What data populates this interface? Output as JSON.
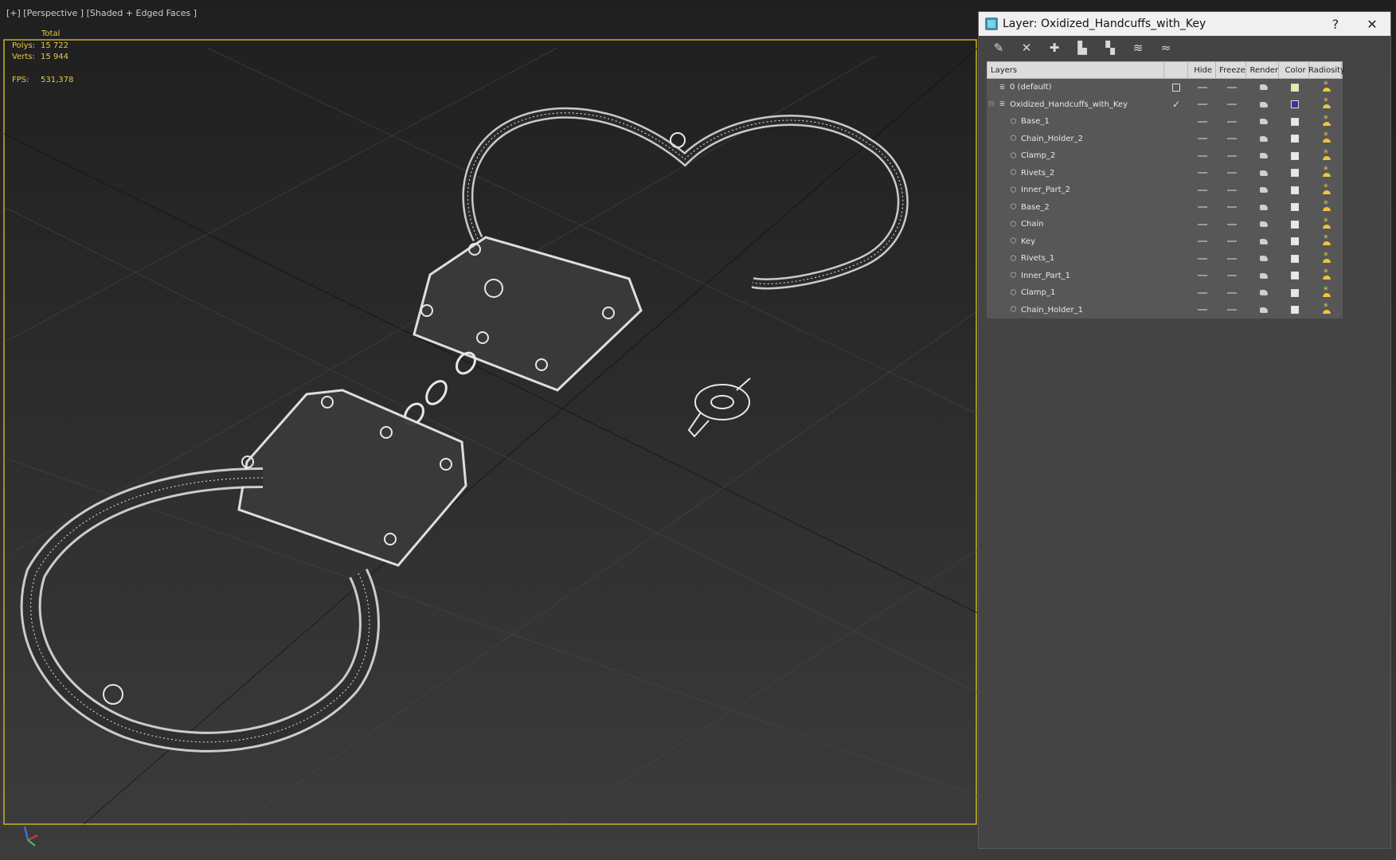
{
  "viewport": {
    "label": "[+] [Perspective ] [Shaded + Edged Faces ]",
    "stats": {
      "total_label": "Total",
      "polys_label": "Polys:",
      "polys": "15 722",
      "verts_label": "Verts:",
      "verts": "15 944",
      "fps_label": "FPS:",
      "fps": "531,378"
    }
  },
  "layer_dialog": {
    "title": "Layer: Oxidized_Handcuffs_with_Key",
    "help": "?",
    "close": "✕",
    "toolbar_icons": [
      "new-layer-icon",
      "delete-layer-icon",
      "add-to-layer-icon",
      "select-objects-icon",
      "select-layer-icon",
      "set-current-layer-icon",
      "hide-freeze-icon"
    ],
    "columns": {
      "layers": "Layers",
      "hide": "Hide",
      "freeze": "Freeze",
      "render": "Render",
      "color": "Color",
      "radiosity": "Radiosity"
    },
    "rows": [
      {
        "name": "0 (default)",
        "level": 0,
        "current": "box",
        "color": "#e8e8a0"
      },
      {
        "name": "Oxidized_Handcuffs_with_Key",
        "level": 0,
        "current": "check",
        "color": "#4b2a9a",
        "expander": "⊟"
      },
      {
        "name": "Base_1",
        "level": 1,
        "color": "#e8e8e8"
      },
      {
        "name": "Chain_Holder_2",
        "level": 1,
        "color": "#e8e8e8"
      },
      {
        "name": "Clamp_2",
        "level": 1,
        "color": "#e8e8e8"
      },
      {
        "name": "Rivets_2",
        "level": 1,
        "color": "#e8e8e8"
      },
      {
        "name": "Inner_Part_2",
        "level": 1,
        "color": "#e8e8e8"
      },
      {
        "name": "Base_2",
        "level": 1,
        "color": "#e8e8e8"
      },
      {
        "name": "Chain",
        "level": 1,
        "color": "#e8e8e8"
      },
      {
        "name": "Key",
        "level": 1,
        "color": "#e8e8e8"
      },
      {
        "name": "Rivets_1",
        "level": 1,
        "color": "#e8e8e8"
      },
      {
        "name": "Inner_Part_1",
        "level": 1,
        "color": "#e8e8e8"
      },
      {
        "name": "Clamp_1",
        "level": 1,
        "color": "#e8e8e8"
      },
      {
        "name": "Chain_Holder_1",
        "level": 1,
        "color": "#e8e8e8"
      }
    ]
  },
  "colors": {
    "stats_text": "#e5c84a",
    "viewport_border": "#c8b41e",
    "wireframe": "#e6e6e6"
  }
}
